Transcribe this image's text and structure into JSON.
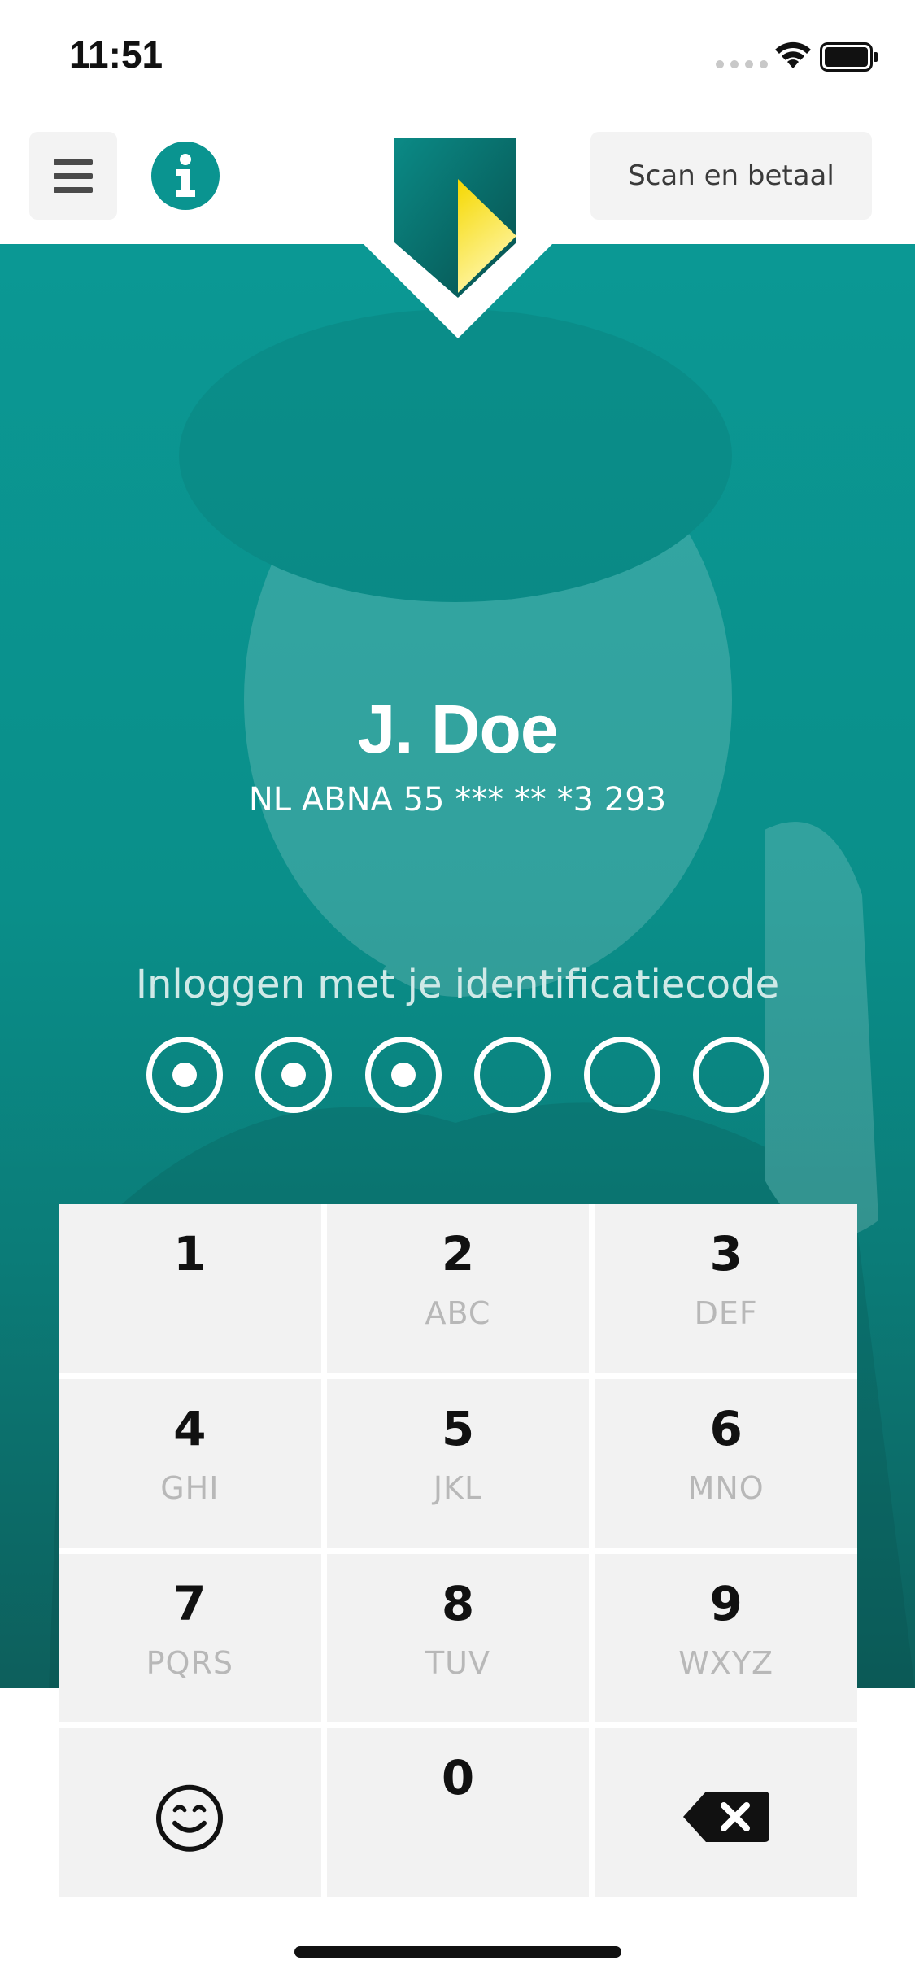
{
  "status_bar": {
    "time": "11:51"
  },
  "header": {
    "scan_button_label": "Scan en betaal"
  },
  "profile": {
    "name": "J. Doe",
    "account_number": "NL ABNA 55 *** ** *3 293"
  },
  "login": {
    "prompt": "Inloggen met je identificatiecode",
    "pin_length": 6,
    "digits_entered": 3
  },
  "keypad": {
    "keys": [
      {
        "digit": "1",
        "letters": ""
      },
      {
        "digit": "2",
        "letters": "ABC"
      },
      {
        "digit": "3",
        "letters": "DEF"
      },
      {
        "digit": "4",
        "letters": "GHI"
      },
      {
        "digit": "5",
        "letters": "JKL"
      },
      {
        "digit": "6",
        "letters": "MNO"
      },
      {
        "digit": "7",
        "letters": "PQRS"
      },
      {
        "digit": "8",
        "letters": "TUV"
      },
      {
        "digit": "9",
        "letters": "WXYZ"
      },
      {
        "icon": "smiley-icon"
      },
      {
        "digit": "0",
        "letters": ""
      },
      {
        "icon": "backspace-icon"
      }
    ]
  },
  "colors": {
    "brand_teal": "#0a9490",
    "brand_yellow": "#f5d800",
    "key_background": "#f2f2f2"
  }
}
